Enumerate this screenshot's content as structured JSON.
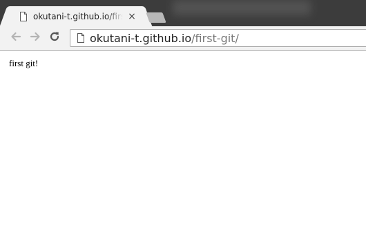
{
  "browser": {
    "tab": {
      "title": "okutani-t.github.io/first-git/",
      "close_glyph": "×",
      "icon": "document-icon"
    },
    "toolbar": {
      "back_icon": "arrow-left-icon",
      "forward_icon": "arrow-right-icon",
      "reload_icon": "reload-icon"
    },
    "address_bar": {
      "host": "okutani-t.github.io",
      "path": "/first-git/",
      "icon": "document-icon"
    }
  },
  "page": {
    "text": "first git!"
  },
  "colors": {
    "frame": "#3c3c3c",
    "tab": "#f2f2f2",
    "url_path": "#777777"
  }
}
